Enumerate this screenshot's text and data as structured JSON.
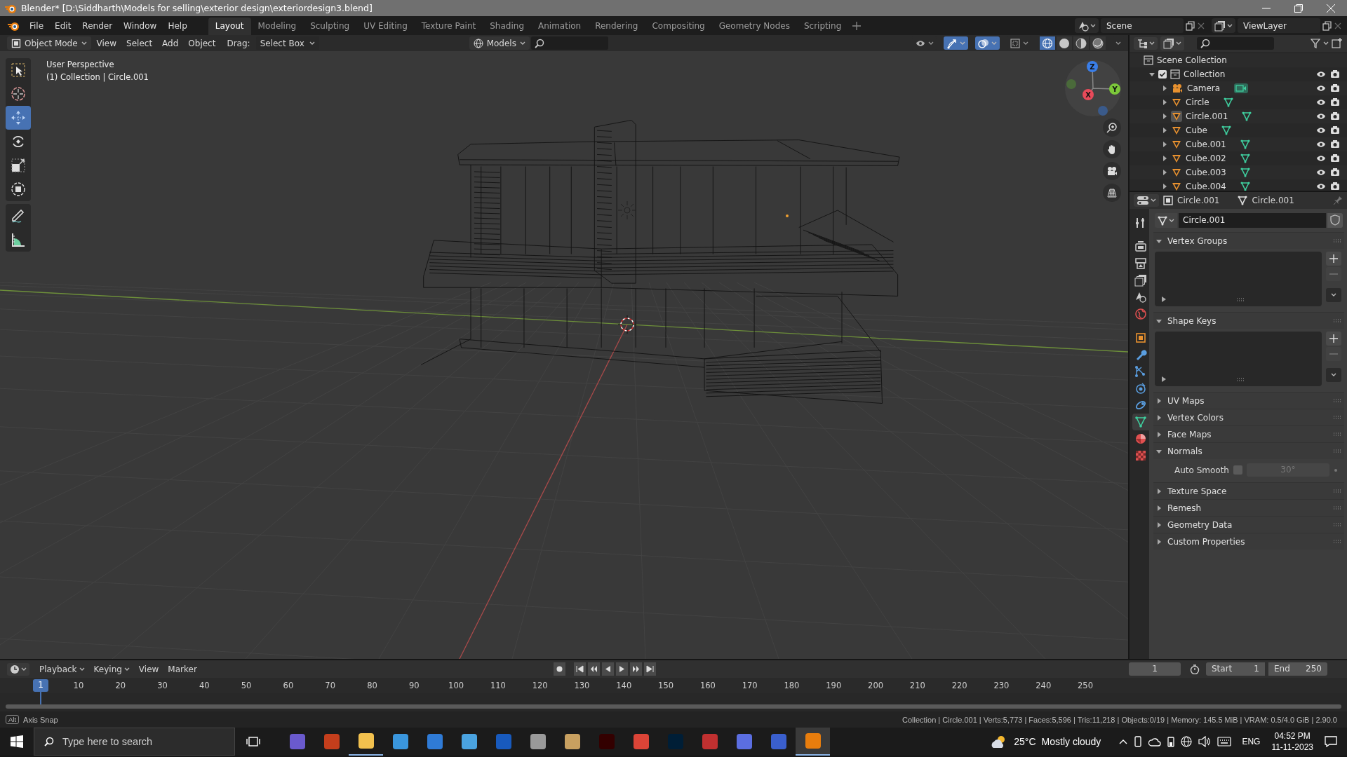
{
  "window": {
    "title": "Blender* [D:\\Siddharth\\Models for selling\\exterior design\\exteriordesign3.blend]"
  },
  "menus": [
    "File",
    "Edit",
    "Render",
    "Window",
    "Help"
  ],
  "workspaces": [
    {
      "label": "Layout",
      "selected": true
    },
    {
      "label": "Modeling",
      "selected": false
    },
    {
      "label": "Sculpting",
      "selected": false
    },
    {
      "label": "UV Editing",
      "selected": false
    },
    {
      "label": "Texture Paint",
      "selected": false
    },
    {
      "label": "Shading",
      "selected": false
    },
    {
      "label": "Animation",
      "selected": false
    },
    {
      "label": "Rendering",
      "selected": false
    },
    {
      "label": "Compositing",
      "selected": false
    },
    {
      "label": "Geometry Nodes",
      "selected": false
    },
    {
      "label": "Scripting",
      "selected": false
    }
  ],
  "scene": {
    "value": "Scene"
  },
  "view_layer": {
    "value": "ViewLayer"
  },
  "viewport_header": {
    "mode": "Object Mode",
    "menus": [
      "View",
      "Select",
      "Add",
      "Object"
    ],
    "drag_label": "Drag:",
    "drag_value": "Select Box",
    "orientation": "Models",
    "toggles": [
      {
        "kind": "visibility",
        "on": false
      },
      {
        "kind": "gizmos",
        "on": true
      },
      {
        "kind": "overlays",
        "on": true
      },
      {
        "kind": "xray",
        "on": false
      }
    ],
    "shading": [
      {
        "kind": "wireframe",
        "selected": true
      },
      {
        "kind": "solid",
        "selected": false
      },
      {
        "kind": "material",
        "selected": false
      },
      {
        "kind": "rendered",
        "selected": false
      }
    ]
  },
  "viewport": {
    "view_name": "User Perspective",
    "context": "(1) Collection | Circle.001",
    "gizmo_axes": {
      "x": "X",
      "y": "Y",
      "z": "Z"
    }
  },
  "tools": [
    {
      "kind": "select_box",
      "selected": false
    },
    {
      "kind": "cursor",
      "selected": false
    },
    {
      "kind": "move",
      "selected": true
    },
    {
      "kind": "rotate",
      "selected": false
    },
    {
      "kind": "scale",
      "selected": false
    },
    {
      "kind": "transform",
      "selected": false
    },
    {
      "kind": "annotate",
      "selected": false
    },
    {
      "kind": "measure",
      "selected": false
    }
  ],
  "outliner": {
    "root": "Scene Collection",
    "collections": [
      {
        "name": "Collection",
        "checked": true,
        "expanded": true,
        "children": [
          {
            "name": "Camera",
            "kind": "camera",
            "expanded": false,
            "selected": false
          },
          {
            "name": "Circle",
            "kind": "mesh",
            "expanded": false,
            "selected": false
          },
          {
            "name": "Circle.001",
            "kind": "mesh",
            "expanded": false,
            "selected": true
          },
          {
            "name": "Cube",
            "kind": "mesh",
            "expanded": false,
            "selected": false
          },
          {
            "name": "Cube.001",
            "kind": "mesh",
            "expanded": false,
            "selected": false
          },
          {
            "name": "Cube.002",
            "kind": "mesh",
            "expanded": false,
            "selected": false
          },
          {
            "name": "Cube.003",
            "kind": "mesh",
            "expanded": false,
            "selected": false
          },
          {
            "name": "Cube.004",
            "kind": "mesh",
            "expanded": false,
            "selected": false
          }
        ]
      }
    ]
  },
  "properties": {
    "object": "Circle.001",
    "data": "Circle.001",
    "data_name": "Circle.001",
    "tabs": [
      {
        "kind": "tool",
        "selected": false
      },
      {
        "kind": "render",
        "selected": false
      },
      {
        "kind": "output",
        "selected": false
      },
      {
        "kind": "view_layer",
        "selected": false
      },
      {
        "kind": "scene",
        "selected": false
      },
      {
        "kind": "world",
        "selected": false
      },
      {
        "kind": "object",
        "selected": false
      },
      {
        "kind": "modifiers",
        "selected": false
      },
      {
        "kind": "particles",
        "selected": false
      },
      {
        "kind": "physics",
        "selected": false
      },
      {
        "kind": "constraints",
        "selected": false
      },
      {
        "kind": "data",
        "selected": true
      },
      {
        "kind": "material",
        "selected": false
      },
      {
        "kind": "texture",
        "selected": false
      }
    ],
    "panels": [
      {
        "title": "Vertex Groups",
        "kind": "list",
        "expanded": true
      },
      {
        "title": "Shape Keys",
        "kind": "list",
        "expanded": true
      },
      {
        "title": "UV Maps",
        "kind": "plain",
        "expanded": false
      },
      {
        "title": "Vertex Colors",
        "kind": "plain",
        "expanded": false
      },
      {
        "title": "Face Maps",
        "kind": "plain",
        "expanded": false
      },
      {
        "title": "Normals",
        "kind": "normals",
        "expanded": true,
        "auto_smooth": {
          "label": "Auto Smooth",
          "checked": false,
          "angle": "30°",
          "disabled": true
        }
      },
      {
        "title": "Texture Space",
        "kind": "plain",
        "expanded": false
      },
      {
        "title": "Remesh",
        "kind": "plain",
        "expanded": false
      },
      {
        "title": "Geometry Data",
        "kind": "plain",
        "expanded": false
      },
      {
        "title": "Custom Properties",
        "kind": "plain",
        "expanded": false
      }
    ]
  },
  "timeline": {
    "menus": [
      "Playback",
      "Keying",
      "View",
      "Marker"
    ],
    "current_frame": "1",
    "start_label": "Start",
    "start": "1",
    "end_label": "End",
    "end": "250",
    "playhead": "1",
    "ruler": [
      "10",
      "20",
      "30",
      "40",
      "50",
      "60",
      "70",
      "80",
      "90",
      "100",
      "110",
      "120",
      "130",
      "140",
      "150",
      "160",
      "170",
      "180",
      "190",
      "200",
      "210",
      "220",
      "230",
      "240",
      "250"
    ]
  },
  "status_bar": {
    "key": "Alt",
    "hint": "Axis Snap",
    "stats": "Collection | Circle.001 | Verts:5,773 | Faces:5,596 | Tris:11,218 | Objects:0/19 | Memory: 145.5 MiB | VRAM: 0.5/4.0 GiB | 2.90.0"
  },
  "taskbar": {
    "search_placeholder": "Type here to search",
    "apps": [
      {
        "color": "#6a5acd",
        "running": false,
        "active": false
      },
      {
        "color": "#c43e1c",
        "running": false,
        "active": false
      },
      {
        "color": "#f2c14e",
        "running": true,
        "active": false
      },
      {
        "color": "#3a96dd",
        "running": false,
        "active": false
      },
      {
        "color": "#2f7bd6",
        "running": false,
        "active": false
      },
      {
        "color": "#4aa3e0",
        "running": false,
        "active": false
      },
      {
        "color": "#185abd",
        "running": false,
        "active": false
      },
      {
        "color": "#9a9a9a",
        "running": false,
        "active": false
      },
      {
        "color": "#c8a060",
        "running": false,
        "active": false
      },
      {
        "color": "#330000",
        "running": false,
        "active": false
      },
      {
        "color": "#db4437",
        "running": false,
        "active": false
      },
      {
        "color": "#001e36",
        "running": false,
        "active": false
      },
      {
        "color": "#c03030",
        "running": false,
        "active": false
      },
      {
        "color": "#5b6ee1",
        "running": false,
        "active": false
      },
      {
        "color": "#3a5fcd",
        "running": false,
        "active": false
      },
      {
        "color": "#e87d0d",
        "running": true,
        "active": true
      }
    ],
    "temperature": "25°C",
    "weather": "Mostly cloudy",
    "language": "ENG",
    "time": "04:52 PM",
    "date": "11-11-2023"
  }
}
